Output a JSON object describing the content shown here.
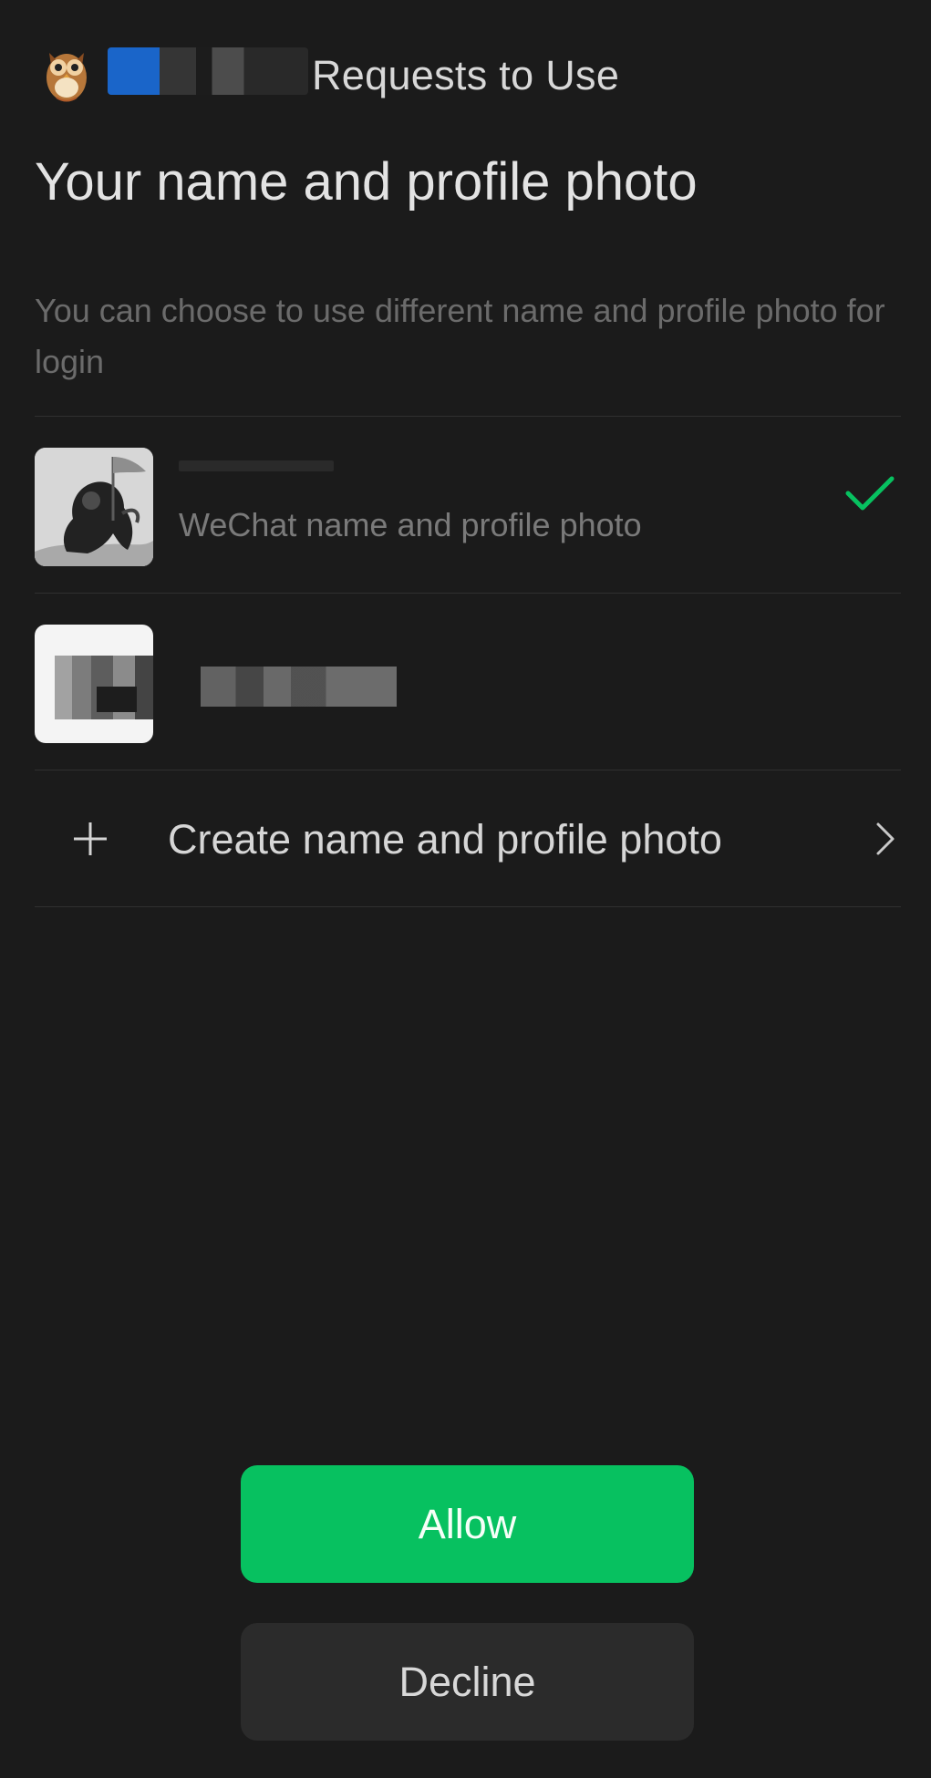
{
  "header": {
    "title": "Requests to Use",
    "app_icon": "owl-app-icon"
  },
  "main": {
    "title": "Your name and profile photo",
    "description": "You can choose to use different name and profile photo for login"
  },
  "options": [
    {
      "subtitle": "WeChat name and profile photo",
      "selected": true
    },
    {
      "subtitle": "",
      "selected": false
    }
  ],
  "create_option": {
    "label": "Create name and profile photo",
    "icon_left": "plus-icon",
    "icon_right": "chevron-right-icon"
  },
  "actions": {
    "allow_label": "Allow",
    "decline_label": "Decline"
  },
  "colors": {
    "background": "#1b1b1b",
    "accent": "#07c160",
    "secondary_button": "#2b2b2b",
    "muted_text": "#6b6b6b"
  }
}
